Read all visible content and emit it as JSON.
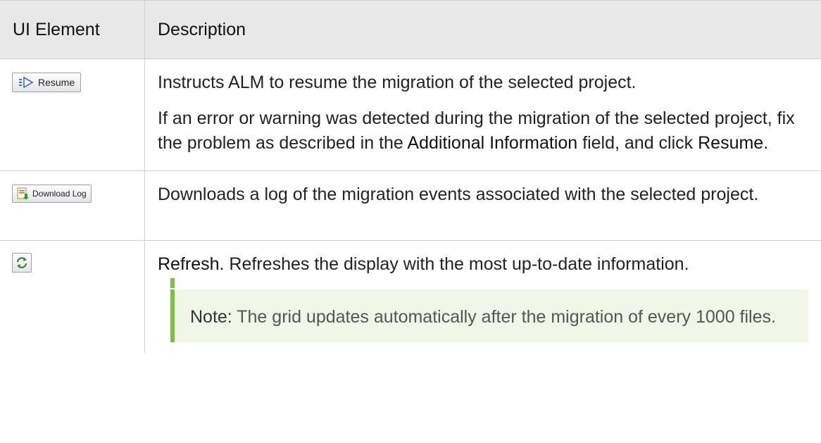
{
  "headers": {
    "col1": "UI Element",
    "col2": "Description"
  },
  "rows": [
    {
      "icon": "resume-icon",
      "button_label": "Resume",
      "para1": "Instructs ALM to resume the migration of the selected project.",
      "para2_a": "If an error or warning was detected during the migration of the selected project, fix the problem as described in the ",
      "para2_b": "Additional Information",
      "para2_c": " field, and click ",
      "para2_d": "Resume",
      "para2_e": "."
    },
    {
      "icon": "download-log-icon",
      "button_label": "Download Log",
      "para1": "Downloads a log of the migration events associated with the selected project."
    },
    {
      "icon": "refresh-icon",
      "para1_a": "Refresh.",
      "para1_b": " Refreshes the display with the most up-to-date information.",
      "note_label": "Note:",
      "note_text": " The grid updates automatically after the migration of every 1000 files."
    }
  ],
  "colors": {
    "note_bg": "#f1f6e9",
    "note_accent": "#7ac143",
    "header_bg": "#e8e8e8"
  }
}
